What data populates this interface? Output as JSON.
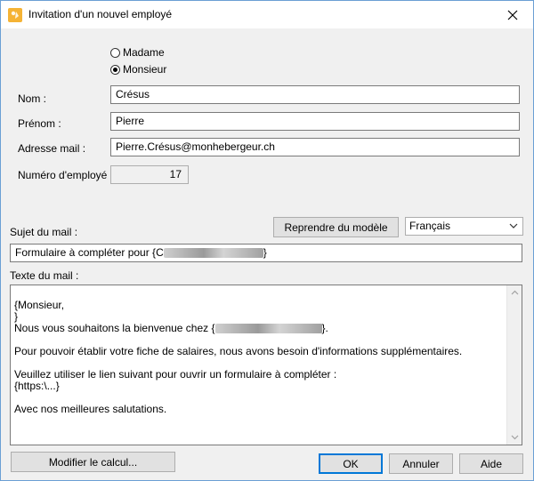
{
  "window": {
    "title": "Invitation d'un nouvel employé"
  },
  "salutation": {
    "options": [
      "Madame",
      "Monsieur"
    ],
    "selected": "Monsieur"
  },
  "form": {
    "nom_label": "Nom :",
    "nom_value": "Crésus",
    "prenom_label": "Prénom :",
    "prenom_value": "Pierre",
    "email_label": "Adresse mail :",
    "email_value": "Pierre.Crésus@monhebergeur.ch",
    "numero_label": "Numéro d'employé :",
    "numero_value": "17"
  },
  "mail": {
    "subject_label": "Sujet du mail :",
    "reset_button": "Reprendre du modèle",
    "language": "Français",
    "subject_prefix": "Formulaire à compléter pour {C",
    "subject_suffix": "}",
    "body_label": "Texte du mail :",
    "body_lines": {
      "l1": "{Monsieur,",
      "l2": "}",
      "l3_prefix": "Nous vous souhaitons la bienvenue chez {",
      "l3_suffix": "}.",
      "l4": "",
      "l5": "Pour pouvoir établir votre fiche de salaires, nous avons besoin d'informations supplémentaires.",
      "l6": "",
      "l7": "Veuillez utiliser le lien suivant pour ouvrir un formulaire à compléter :",
      "l8": "{https:\\...}",
      "l9": "",
      "l10": "Avec nos meilleures salutations."
    }
  },
  "buttons": {
    "modify": "Modifier le calcul...",
    "ok": "OK",
    "cancel": "Annuler",
    "help": "Aide"
  }
}
